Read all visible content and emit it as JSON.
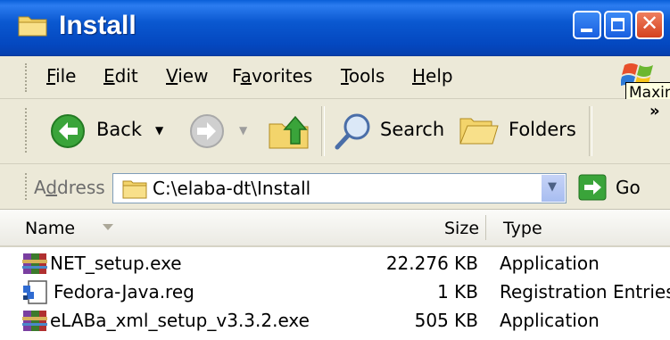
{
  "window": {
    "title": "Install",
    "colors": {
      "title_bar": "#0a58d0",
      "close_button": "#d4421e",
      "chrome": "#ece9d8"
    }
  },
  "menu": {
    "items": [
      {
        "accel": "F",
        "rest": "ile"
      },
      {
        "accel": "E",
        "rest": "dit"
      },
      {
        "accel": "V",
        "rest": "iew"
      },
      {
        "pre": "F",
        "accel": "a",
        "rest": "vorites"
      },
      {
        "accel": "T",
        "rest": "ools"
      },
      {
        "accel": "H",
        "rest": "elp"
      }
    ],
    "tooltip": "Maxim",
    "chevron": "»"
  },
  "toolbar": {
    "back_label": "Back",
    "search_label": "Search",
    "folders_label": "Folders",
    "icons": [
      "back-arrow-icon",
      "forward-arrow-icon",
      "up-folder-icon",
      "search-icon",
      "folders-icon"
    ]
  },
  "address": {
    "label_pre": "A",
    "label_accel": "d",
    "label_rest": "dress",
    "value": "C:\\elaba-dt\\Install",
    "go_label": "Go"
  },
  "list": {
    "columns": {
      "name": "Name",
      "size": "Size",
      "type": "Type"
    },
    "rows": [
      {
        "name": "NET_setup.exe",
        "size": "22.276 KB",
        "type": "Application",
        "icon": "winrar-installer-icon"
      },
      {
        "name": "Fedora-Java.reg",
        "size": "1 KB",
        "type": "Registration Entries",
        "icon": "registry-file-icon"
      },
      {
        "name": "eLABa_xml_setup_v3.3.2.exe",
        "size": "505 KB",
        "type": "Application",
        "icon": "winrar-installer-icon"
      }
    ]
  }
}
